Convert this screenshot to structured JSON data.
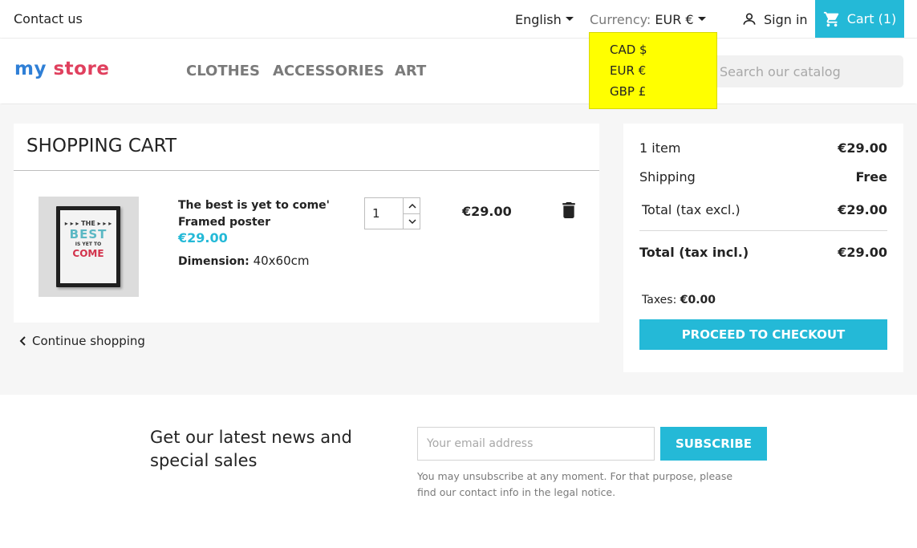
{
  "topbar": {
    "contact": "Contact us",
    "language": "English",
    "currency_label": "Currency:",
    "currency_value": "EUR €",
    "signin": "Sign in",
    "cart": "Cart (1)"
  },
  "currency_dropdown": {
    "options": [
      "CAD $",
      "EUR €",
      "GBP £"
    ]
  },
  "header": {
    "logo": {
      "word1": "my",
      "word2": "store"
    },
    "nav": [
      "CLOTHES",
      "ACCESSORIES",
      "ART"
    ],
    "search_placeholder": "Search our catalog"
  },
  "cart": {
    "title": "SHOPPING CART",
    "item": {
      "name": "The best is yet to come' Framed poster",
      "price": "€29.00",
      "dimension_label": "Dimension:",
      "dimension_value": "40x60cm",
      "quantity": "1",
      "line_total": "€29.00",
      "poster_text": {
        "top": "▸ ▸ ▸ THE ▸ ▸ ▸",
        "best": "BEST",
        "mid": "IS YET TO",
        "come": "COME"
      }
    },
    "continue": "Continue shopping"
  },
  "summary": {
    "items_label": "1 item",
    "items_value": "€29.00",
    "shipping_label": "Shipping",
    "shipping_value": "Free",
    "total_excl_label": "Total (tax excl.)",
    "total_excl_value": "€29.00",
    "total_incl_label": "Total (tax incl.)",
    "total_incl_value": "€29.00",
    "taxes_label": "Taxes:",
    "taxes_value": "€0.00",
    "checkout": "PROCEED TO CHECKOUT"
  },
  "newsletter": {
    "title": "Get our latest news and special sales",
    "email_placeholder": "Your email address",
    "subscribe": "SUBSCRIBE",
    "legal": "You may unsubscribe at any moment. For that purpose, please find our contact info in the legal notice."
  },
  "colors": {
    "accent": "#24b9d7",
    "dropdown_highlight": "#ffff00",
    "text": "#232323",
    "muted": "#7a7a7a"
  }
}
